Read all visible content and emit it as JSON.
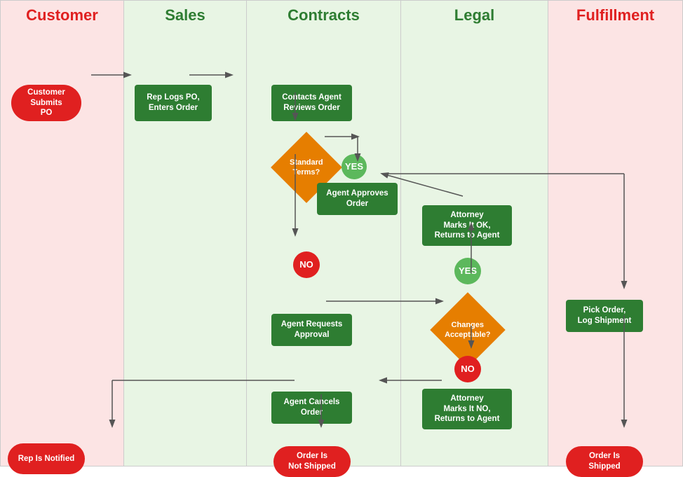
{
  "lanes": [
    {
      "id": "customer",
      "label": "Customer"
    },
    {
      "id": "sales",
      "label": "Sales"
    },
    {
      "id": "contracts",
      "label": "Contracts"
    },
    {
      "id": "legal",
      "label": "Legal"
    },
    {
      "id": "fulfillment",
      "label": "Fulfillment"
    }
  ],
  "nodes": {
    "customer_submit": "Customer Submits\nPO",
    "rep_logs": "Rep Logs PO,\nEnters Order",
    "contacts_agent": "Contacts Agent\nReviews Order",
    "standard_terms": "Standard\nTerms?",
    "agent_approves": "Agent Approves\nOrder",
    "attorney_ok": "Attorney\nMarks It OK,\nReturns to Agent",
    "no_label1": "NO",
    "agent_requests": "Agent Requests\nApproval",
    "changes_acceptable": "Changes\nAcceptable?",
    "yes_label1": "YES",
    "yes_label2": "YES",
    "no_label2": "NO",
    "attorney_no": "Attorney\nMarks It NO,\nReturns to Agent",
    "agent_cancels": "Agent Cancels\nOrder",
    "rep_notified": "Rep Is Notified",
    "order_not_shipped": "Order Is\nNot Shipped",
    "pick_order": "Pick Order,\nLog Shipment",
    "order_shipped": "Order Is Shipped"
  }
}
